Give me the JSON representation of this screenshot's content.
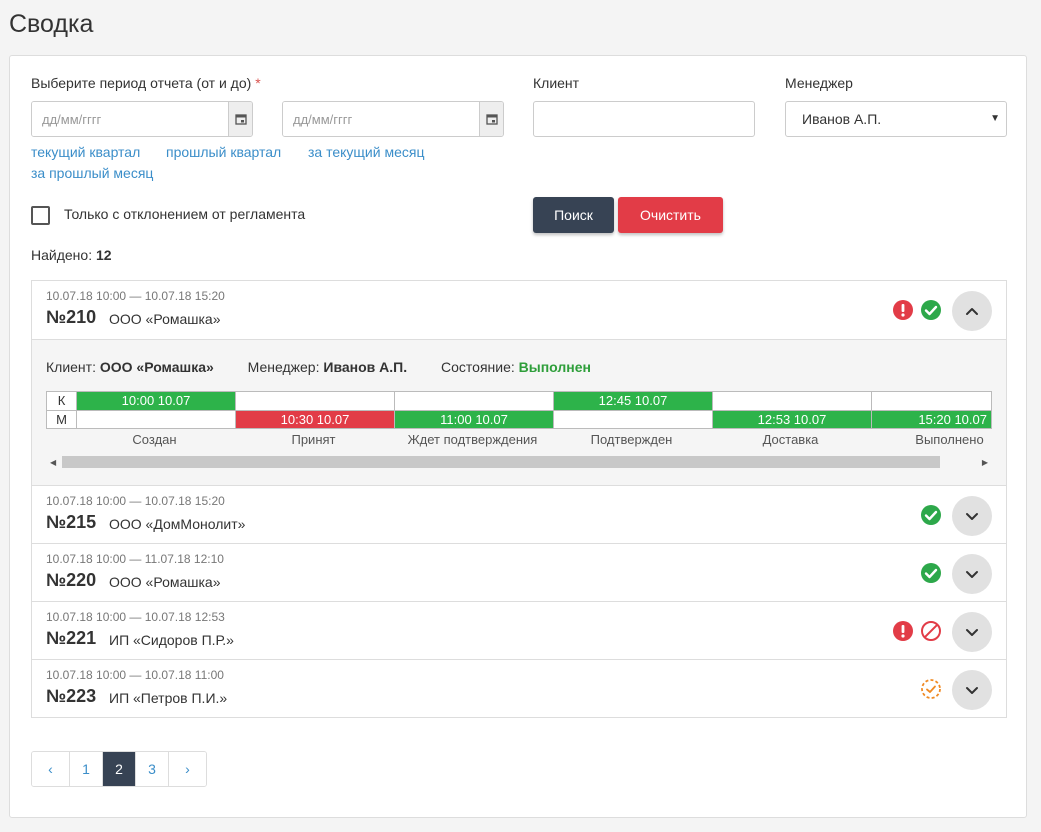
{
  "page": {
    "title": "Сводка"
  },
  "filters": {
    "period_label": "Выберите период отчета (от и до)",
    "required_mark": "*",
    "date_from_placeholder": "дд/мм/гггг",
    "date_to_placeholder": "дд/мм/гггг",
    "client_label": "Клиент",
    "client_value": "",
    "manager_label": "Менеджер",
    "manager_selected": "Иванов А.П.",
    "quick_links": [
      "текущий квартал",
      "прошлый квартал",
      "за текущий месяц",
      "за прошлый месяц"
    ],
    "deviation_only_label": "Только с отклонением от регламента",
    "search_button": "Поиск",
    "clear_button": "Очистить"
  },
  "results": {
    "found_label": "Найдено:",
    "found_count": "12"
  },
  "orders": [
    {
      "period": "10.07.18 10:00 — 10.07.18 15:20",
      "number": "№210",
      "company": "ООО «Ромашка»",
      "icons": [
        "exclamation-icon",
        "check-icon"
      ],
      "expanded": true,
      "details": {
        "client_label": "Клиент:",
        "client_value": "ООО «Ромашка»",
        "manager_label": "Менеджер:",
        "manager_value": "Иванов А.П.",
        "state_label": "Состояние:",
        "state_value": "Выполнен",
        "row_k_label": "К",
        "row_m_label": "М",
        "stages": [
          "Создан",
          "Принят",
          "Ждет подтверждения",
          "Подтвержден",
          "Доставка",
          "Выполнено"
        ],
        "k_times": [
          "10:00 10.07",
          "",
          "",
          "12:45 10.07",
          "",
          ""
        ],
        "m_times": [
          "",
          "10:30 10.07",
          "11:00 10.07",
          "",
          "12:53 10.07",
          "15:20 10.07"
        ]
      }
    },
    {
      "period": "10.07.18 10:00 — 10.07.18 15:20",
      "number": "№215",
      "company": "ООО «ДомМонолит»",
      "icons": [
        "check-icon"
      ],
      "expanded": false
    },
    {
      "period": "10.07.18 10:00 — 11.07.18 12:10",
      "number": "№220",
      "company": "ООО «Ромашка»",
      "icons": [
        "check-icon"
      ],
      "expanded": false
    },
    {
      "period": "10.07.18 10:00 — 10.07.18 12:53",
      "number": "№221",
      "company": "ИП «Сидоров П.Р.»",
      "icons": [
        "exclamation-icon",
        "cancel-icon"
      ],
      "expanded": false
    },
    {
      "period": "10.07.18 10:00 — 10.07.18 11:00",
      "number": "№223",
      "company": "ИП «Петров П.И.»",
      "icons": [
        "pending-check-icon"
      ],
      "expanded": false
    }
  ],
  "pagination": {
    "prev": "‹",
    "pages": [
      "1",
      "2",
      "3"
    ],
    "active": "2",
    "next": "›"
  },
  "colors": {
    "green": "#2db34a",
    "red": "#e23c47",
    "dark": "#374354",
    "link": "#3b8ec9",
    "orange": "#f08a24"
  }
}
